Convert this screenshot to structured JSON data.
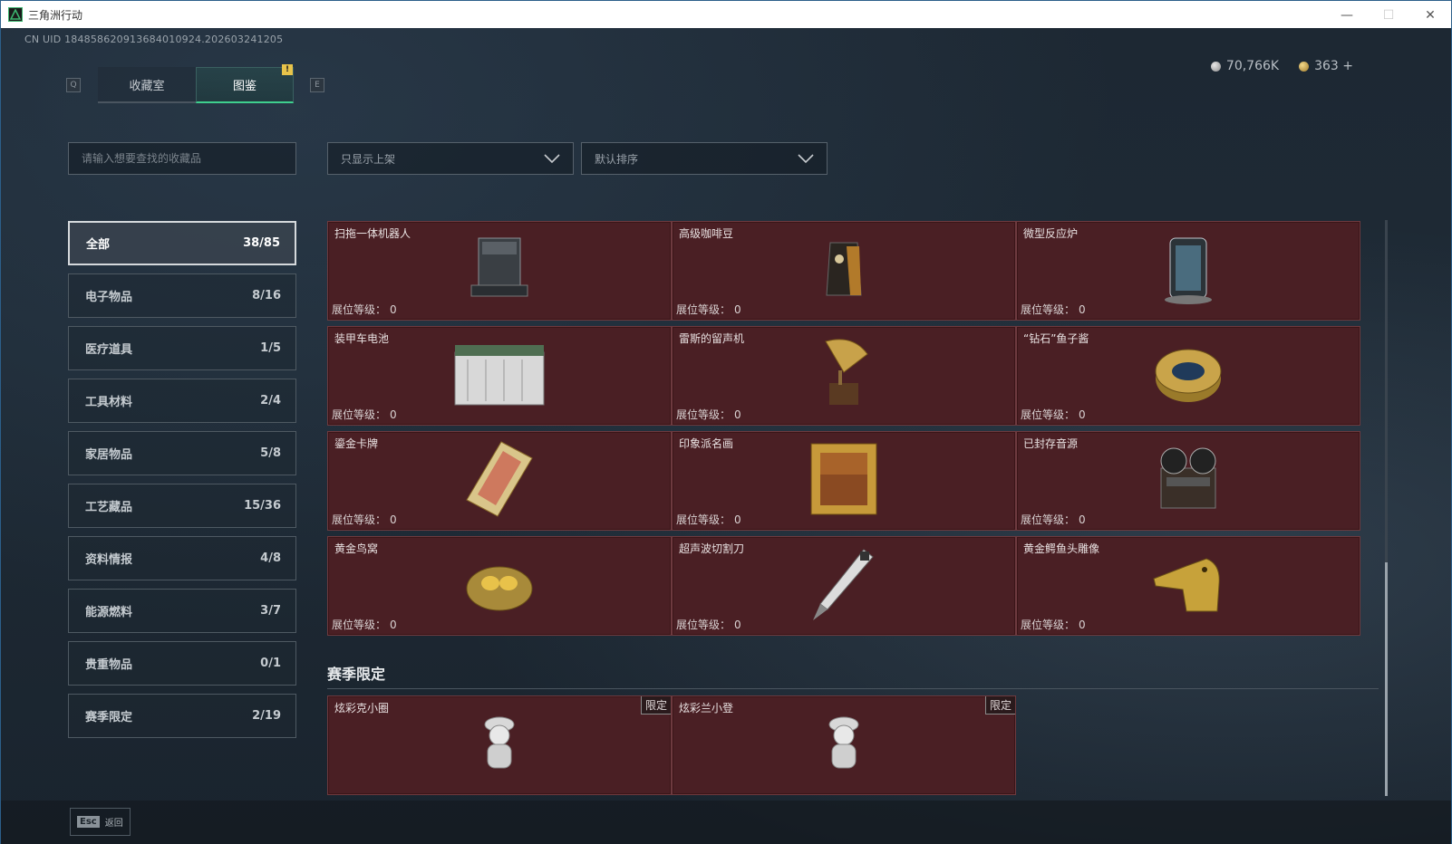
{
  "window": {
    "title": "三角洲行动",
    "minimize": "—",
    "maximize": "☐",
    "close": "✕"
  },
  "uid_text": "CN UID 184858620913684010924.202603241205",
  "currency": {
    "silver": "70,766K",
    "gold": "363 +"
  },
  "tabs": {
    "prev_key": "Q",
    "next_key": "E",
    "items": [
      {
        "label": "收藏室"
      },
      {
        "label": "图鉴",
        "badge": "!"
      }
    ]
  },
  "search": {
    "placeholder": "请输入想要查找的收藏品"
  },
  "filters": {
    "availability": "只显示上架",
    "sort": "默认排序"
  },
  "categories": [
    {
      "label": "全部",
      "count": "38/85"
    },
    {
      "label": "电子物品",
      "count": "8/16"
    },
    {
      "label": "医疗道具",
      "count": "1/5"
    },
    {
      "label": "工具材料",
      "count": "2/4"
    },
    {
      "label": "家居物品",
      "count": "5/8"
    },
    {
      "label": "工艺藏品",
      "count": "15/36"
    },
    {
      "label": "资料情报",
      "count": "4/8"
    },
    {
      "label": "能源燃料",
      "count": "3/7"
    },
    {
      "label": "贵重物品",
      "count": "0/1"
    },
    {
      "label": "赛季限定",
      "count": "2/19"
    }
  ],
  "level_label": "展位等级：",
  "items": [
    {
      "name": "扫拖一体机器人",
      "level": "0",
      "icon": "robot-vacuum-icon"
    },
    {
      "name": "高级咖啡豆",
      "level": "0",
      "icon": "coffee-bag-icon"
    },
    {
      "name": "微型反应炉",
      "level": "0",
      "icon": "reactor-icon"
    },
    {
      "name": "装甲车电池",
      "level": "0",
      "icon": "battery-icon"
    },
    {
      "name": "雷斯的留声机",
      "level": "0",
      "icon": "gramophone-icon"
    },
    {
      "name": "“钻石”鱼子酱",
      "level": "0",
      "icon": "caviar-tin-icon"
    },
    {
      "name": "鎏金卡牌",
      "level": "0",
      "icon": "gold-card-icon"
    },
    {
      "name": "印象派名画",
      "level": "0",
      "icon": "framed-painting-icon"
    },
    {
      "name": "已封存音源",
      "level": "0",
      "icon": "tape-recorder-icon"
    },
    {
      "name": "黄金鸟窝",
      "level": "0",
      "icon": "golden-nest-icon"
    },
    {
      "name": "超声波切割刀",
      "level": "0",
      "icon": "ultrasonic-cutter-icon"
    },
    {
      "name": "黄金鳄鱼头雕像",
      "level": "0",
      "icon": "gold-crocodile-icon"
    }
  ],
  "season": {
    "title": "赛季限定",
    "limited_label": "限定",
    "items": [
      {
        "name": "炫彩克小圈",
        "icon": "figurine-icon"
      },
      {
        "name": "炫彩兰小登",
        "icon": "figurine-icon"
      }
    ]
  },
  "footer": {
    "esc_key": "Esc",
    "esc_label": "返回"
  }
}
